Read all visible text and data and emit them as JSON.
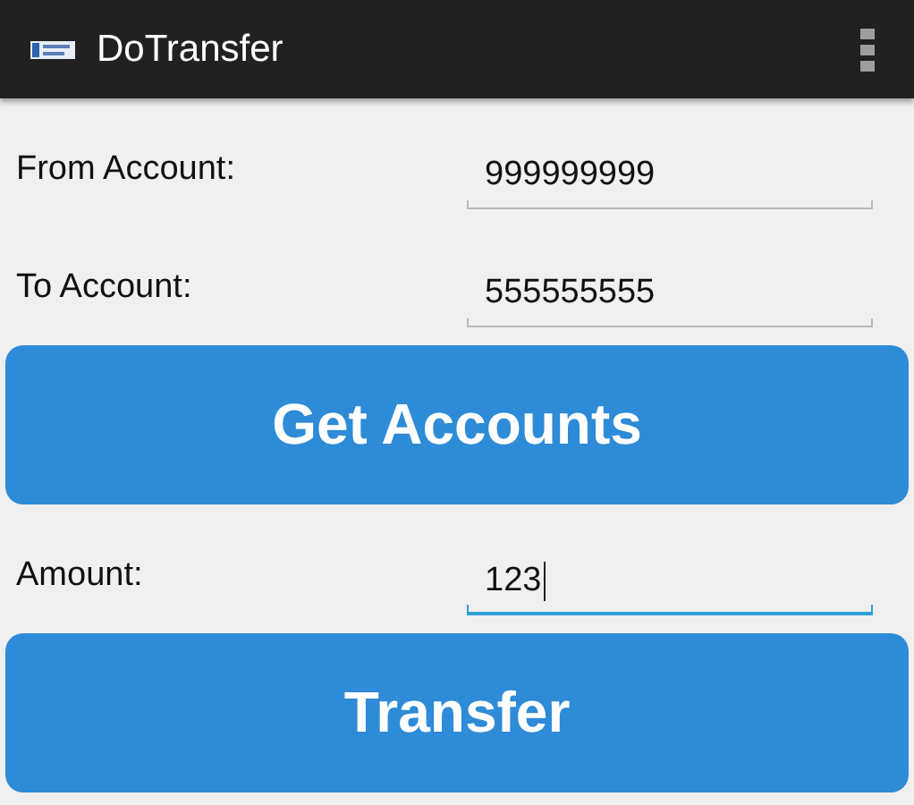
{
  "app_bar": {
    "title": "DoTransfer"
  },
  "rows": [
    {
      "kind": "field",
      "label": "From Account:",
      "value": "999999999",
      "focused": false
    },
    {
      "kind": "field",
      "label": "To Account:",
      "value": "555555555",
      "focused": false
    },
    {
      "kind": "button",
      "label": "Get Accounts"
    },
    {
      "kind": "field",
      "label": "Amount:",
      "value": "123",
      "focused": true
    },
    {
      "kind": "button",
      "label": "Transfer"
    }
  ]
}
